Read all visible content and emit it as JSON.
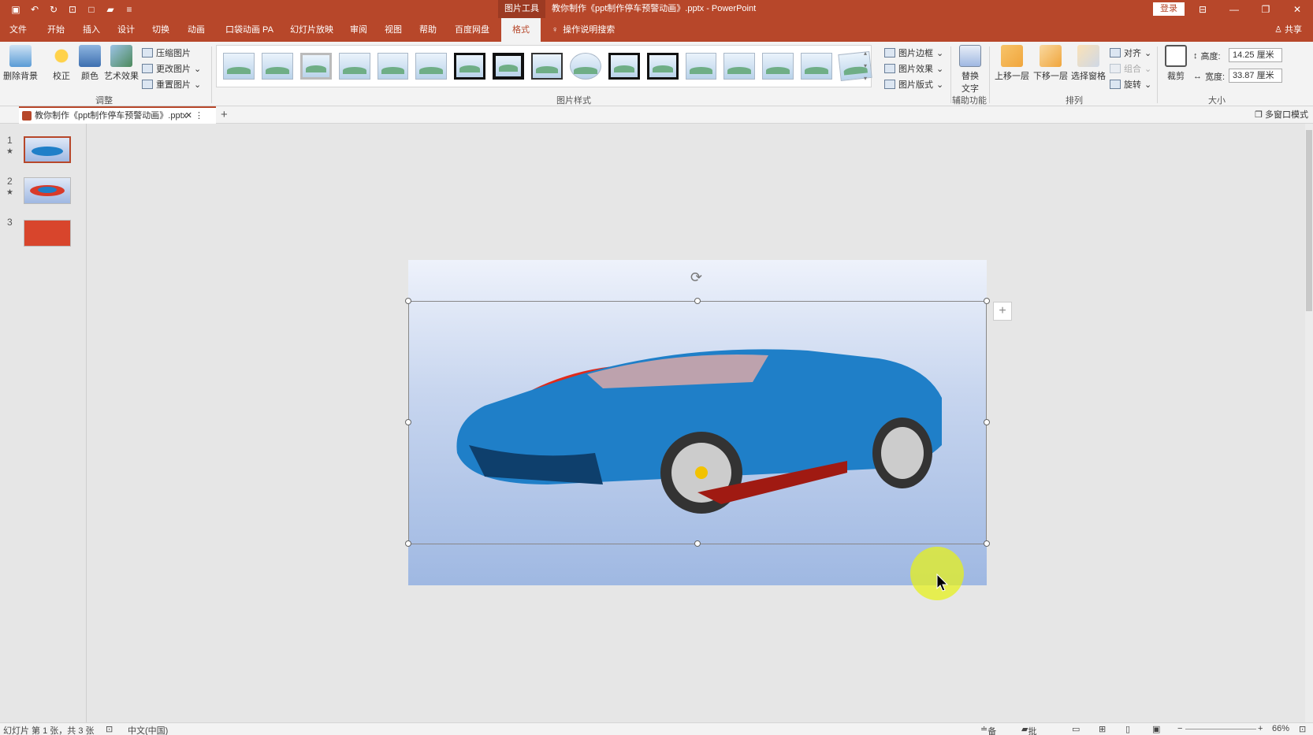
{
  "titlebar": {
    "tools_label": "图片工具",
    "doc_title": "教你制作《ppt制作停车预警动画》.pptx  -  PowerPoint",
    "login": "登录"
  },
  "tabs": [
    "文件",
    "开始",
    "插入",
    "设计",
    "切换",
    "动画",
    "口袋动画 PA",
    "幻灯片放映",
    "审阅",
    "视图",
    "帮助",
    "百度网盘",
    "格式"
  ],
  "active_tab": "格式",
  "tell_me": "操作说明搜索",
  "share": "共享",
  "ribbon": {
    "adjust": {
      "remove_bg": "删除背景",
      "correct": "校正",
      "color": "颜色",
      "art": "艺术效果",
      "compress": "压缩图片",
      "change": "更改图片",
      "reset": "重置图片",
      "label": "调整"
    },
    "styles": {
      "label": "图片样式",
      "border": "图片边框",
      "effects": "图片效果",
      "layout": "图片版式"
    },
    "accessibility": {
      "alt_text_line1": "替换",
      "alt_text_line2": "文字",
      "label": "辅助功能"
    },
    "arrange": {
      "bring_forward": "上移一层",
      "send_backward": "下移一层",
      "selection_pane": "选择窗格",
      "align": "对齐",
      "group": "组合",
      "rotate": "旋转",
      "label": "排列"
    },
    "size": {
      "crop": "裁剪",
      "height_label": "高度:",
      "height_value": "14.25 厘米",
      "width_label": "宽度:",
      "width_value": "33.87 厘米",
      "label": "大小"
    }
  },
  "doctab": {
    "name": "教你制作《ppt制作停车预警动画》.pptx",
    "multiwin": "多窗口模式"
  },
  "thumbnails": [
    {
      "num": "1",
      "star": "★"
    },
    {
      "num": "2",
      "star": "★"
    },
    {
      "num": "3",
      "star": ""
    }
  ],
  "status": {
    "slide": "幻灯片 第 1 张，共 3 张",
    "lang": "中文(中国)",
    "notes": "备注",
    "comments": "批注",
    "zoom": "66%"
  },
  "colors": {
    "accent": "#b7472a",
    "car_body": "#1f7fc8"
  }
}
